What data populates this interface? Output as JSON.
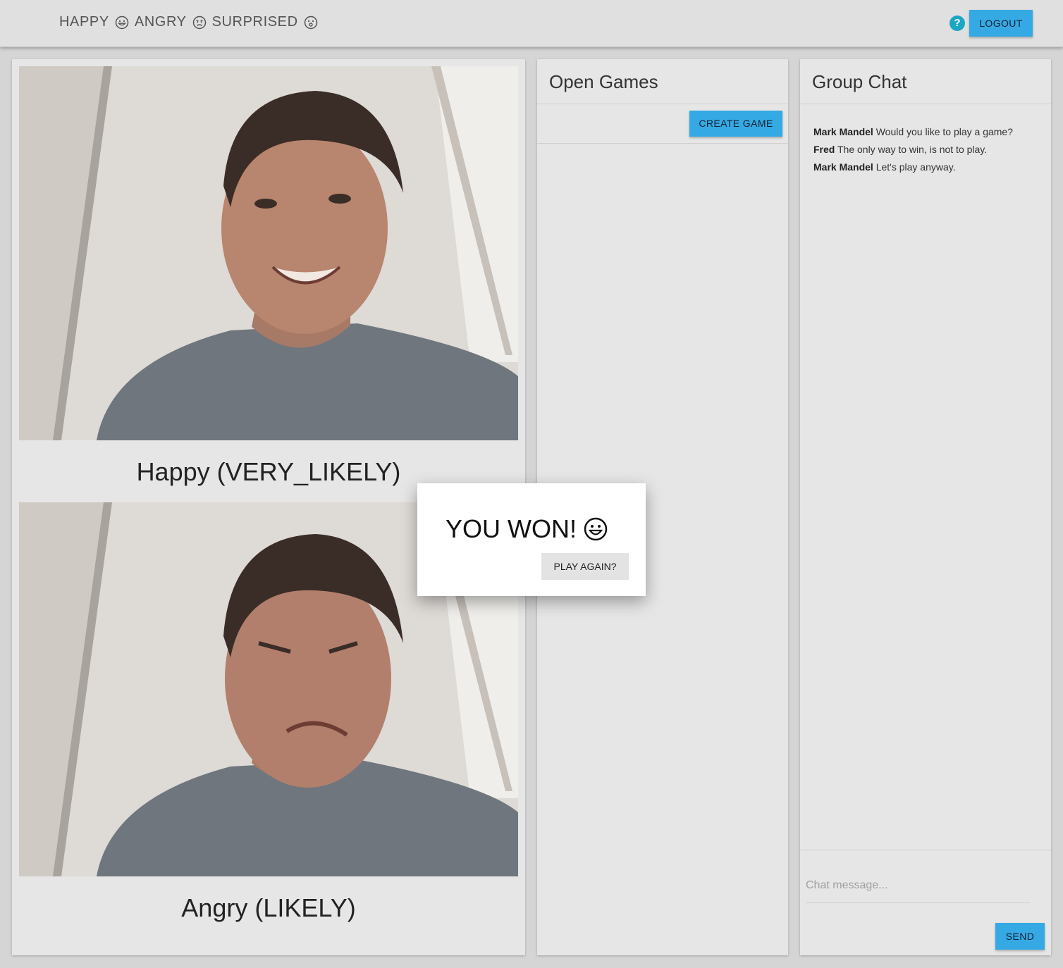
{
  "header": {
    "emotions": [
      {
        "label": "HAPPY",
        "icon": "happy-emoji-icon"
      },
      {
        "label": "ANGRY",
        "icon": "angry-emoji-icon"
      },
      {
        "label": "SURPRISED",
        "icon": "surprised-emoji-icon"
      }
    ],
    "help_icon": "?",
    "logout_label": "LOGOUT",
    "accent": "#35a9e3"
  },
  "faces": [
    {
      "caption": "Happy (VERY_LIKELY)"
    },
    {
      "caption": "Angry (LIKELY)"
    }
  ],
  "games": {
    "title": "Open Games",
    "create_label": "CREATE GAME"
  },
  "chat": {
    "title": "Group Chat",
    "messages": [
      {
        "user": "Mark Mandel",
        "text": "Would you like to play a game?"
      },
      {
        "user": "Fred",
        "text": "The only way to win, is not to play."
      },
      {
        "user": "Mark Mandel",
        "text": "Let's play anyway."
      }
    ],
    "input_placeholder": "Chat message...",
    "send_label": "SEND"
  },
  "dialog": {
    "message": "YOU WON!",
    "icon": "grinning-emoji-icon",
    "play_again_label": "PLAY AGAIN?"
  }
}
